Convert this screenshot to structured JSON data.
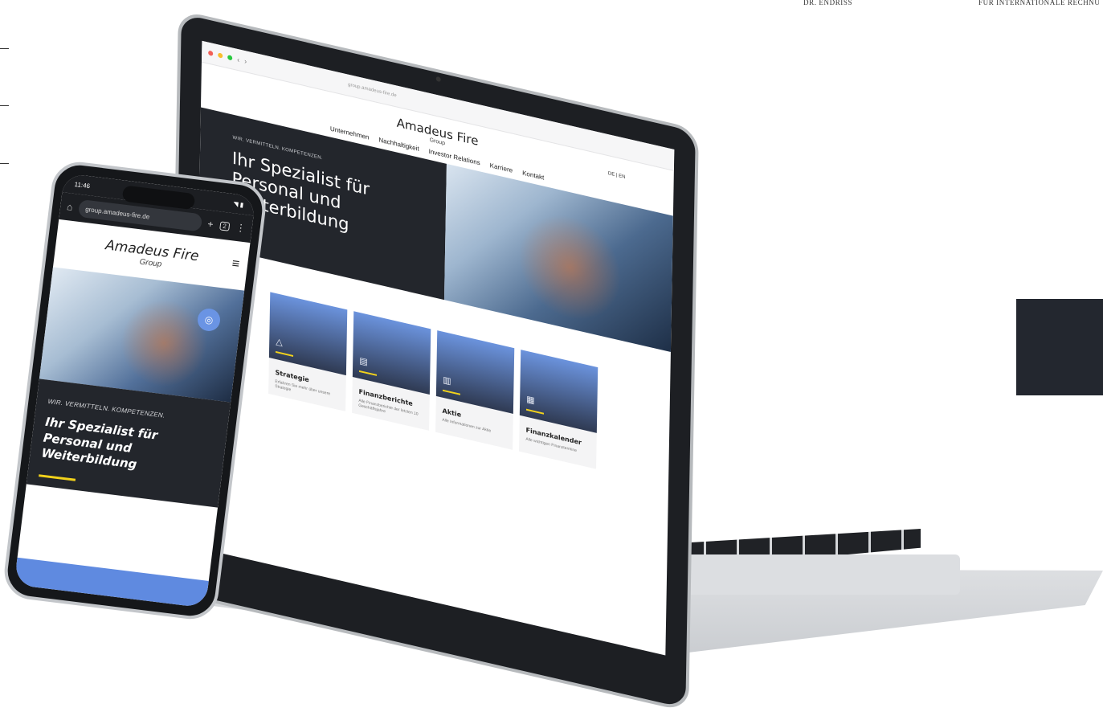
{
  "corner_labels": {
    "left": "DR. ENDRISS",
    "right": "FÜR INTERNATIONALE RECHNU"
  },
  "laptop_site": {
    "url": "group.amadeus-fire.de",
    "logo": "Amadeus Fire",
    "logo_sub": "Group",
    "lang": "DE | EN",
    "nav": [
      "Unternehmen",
      "Nachhaltigkeit",
      "Investor Relations",
      "Karriere",
      "Kontakt"
    ],
    "hero": {
      "eyebrow": "WIR. VERMITTELN. KOMPETENZEN.",
      "title": "Ihr Spezialist für Personal und Weiterbildung"
    },
    "cards": [
      {
        "title": "Strategie",
        "text": "Erfahren Sie mehr über unsere Strategie",
        "icon": "strategy-icon"
      },
      {
        "title": "Finanzberichte",
        "text": "Alle Finanzberichte der letzten 10 Geschäftsjahre",
        "icon": "report-icon"
      },
      {
        "title": "Aktie",
        "text": "Alle Informationen zur Aktie",
        "icon": "chart-icon"
      },
      {
        "title": "Finanzkalender",
        "text": "Alle wichtigen Finanztermine",
        "icon": "calendar-icon"
      }
    ]
  },
  "phone_site": {
    "time": "11:46",
    "url": "group.amadeus-fire.de",
    "tabs_count": "2",
    "logo": "Amadeus Fire",
    "logo_sub": "Group",
    "hero": {
      "eyebrow": "WIR. VERMITTELN. KOMPETENZEN.",
      "title": "Ihr Spezialist für Personal und Weiterbildung"
    }
  },
  "colors": {
    "accent": "#f2d21b",
    "dark": "#23262c",
    "blue": "#5f8ae0"
  }
}
